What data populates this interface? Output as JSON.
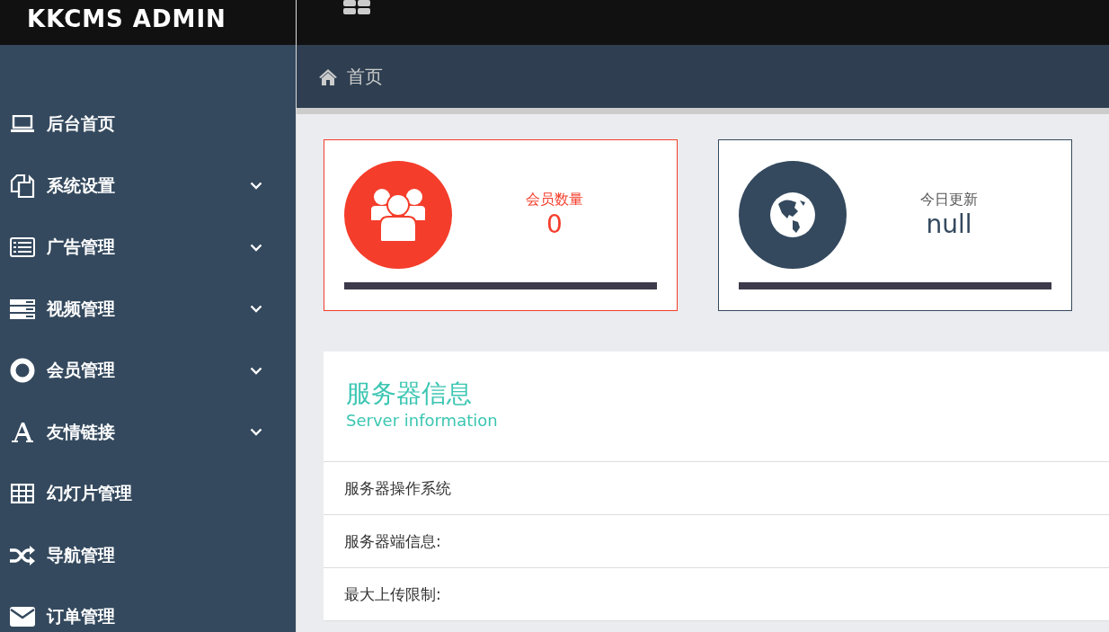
{
  "brand": "KKCMS ADMIN",
  "breadcrumb": "首页",
  "sidebar": {
    "items": [
      {
        "label": "后台首页",
        "kind": "link"
      },
      {
        "label": "系统设置",
        "kind": "group"
      },
      {
        "label": "广告管理",
        "kind": "group"
      },
      {
        "label": "视频管理",
        "kind": "group"
      },
      {
        "label": "会员管理",
        "kind": "group"
      },
      {
        "label": "友情链接",
        "kind": "group"
      },
      {
        "label": "幻灯片管理",
        "kind": "link"
      },
      {
        "label": "导航管理",
        "kind": "link"
      },
      {
        "label": "订单管理",
        "kind": "link"
      }
    ]
  },
  "stats": [
    {
      "label": "会员数量",
      "value": "0",
      "color": "#f43d2b"
    },
    {
      "label": "今日更新",
      "value": "null",
      "color": "#34495e"
    }
  ],
  "server_panel": {
    "title": "服务器信息",
    "subtitle": "Server information",
    "rows": [
      {
        "label": "服务器操作系统"
      },
      {
        "label": "服务器端信息:"
      },
      {
        "label": "最大上传限制:"
      }
    ]
  }
}
